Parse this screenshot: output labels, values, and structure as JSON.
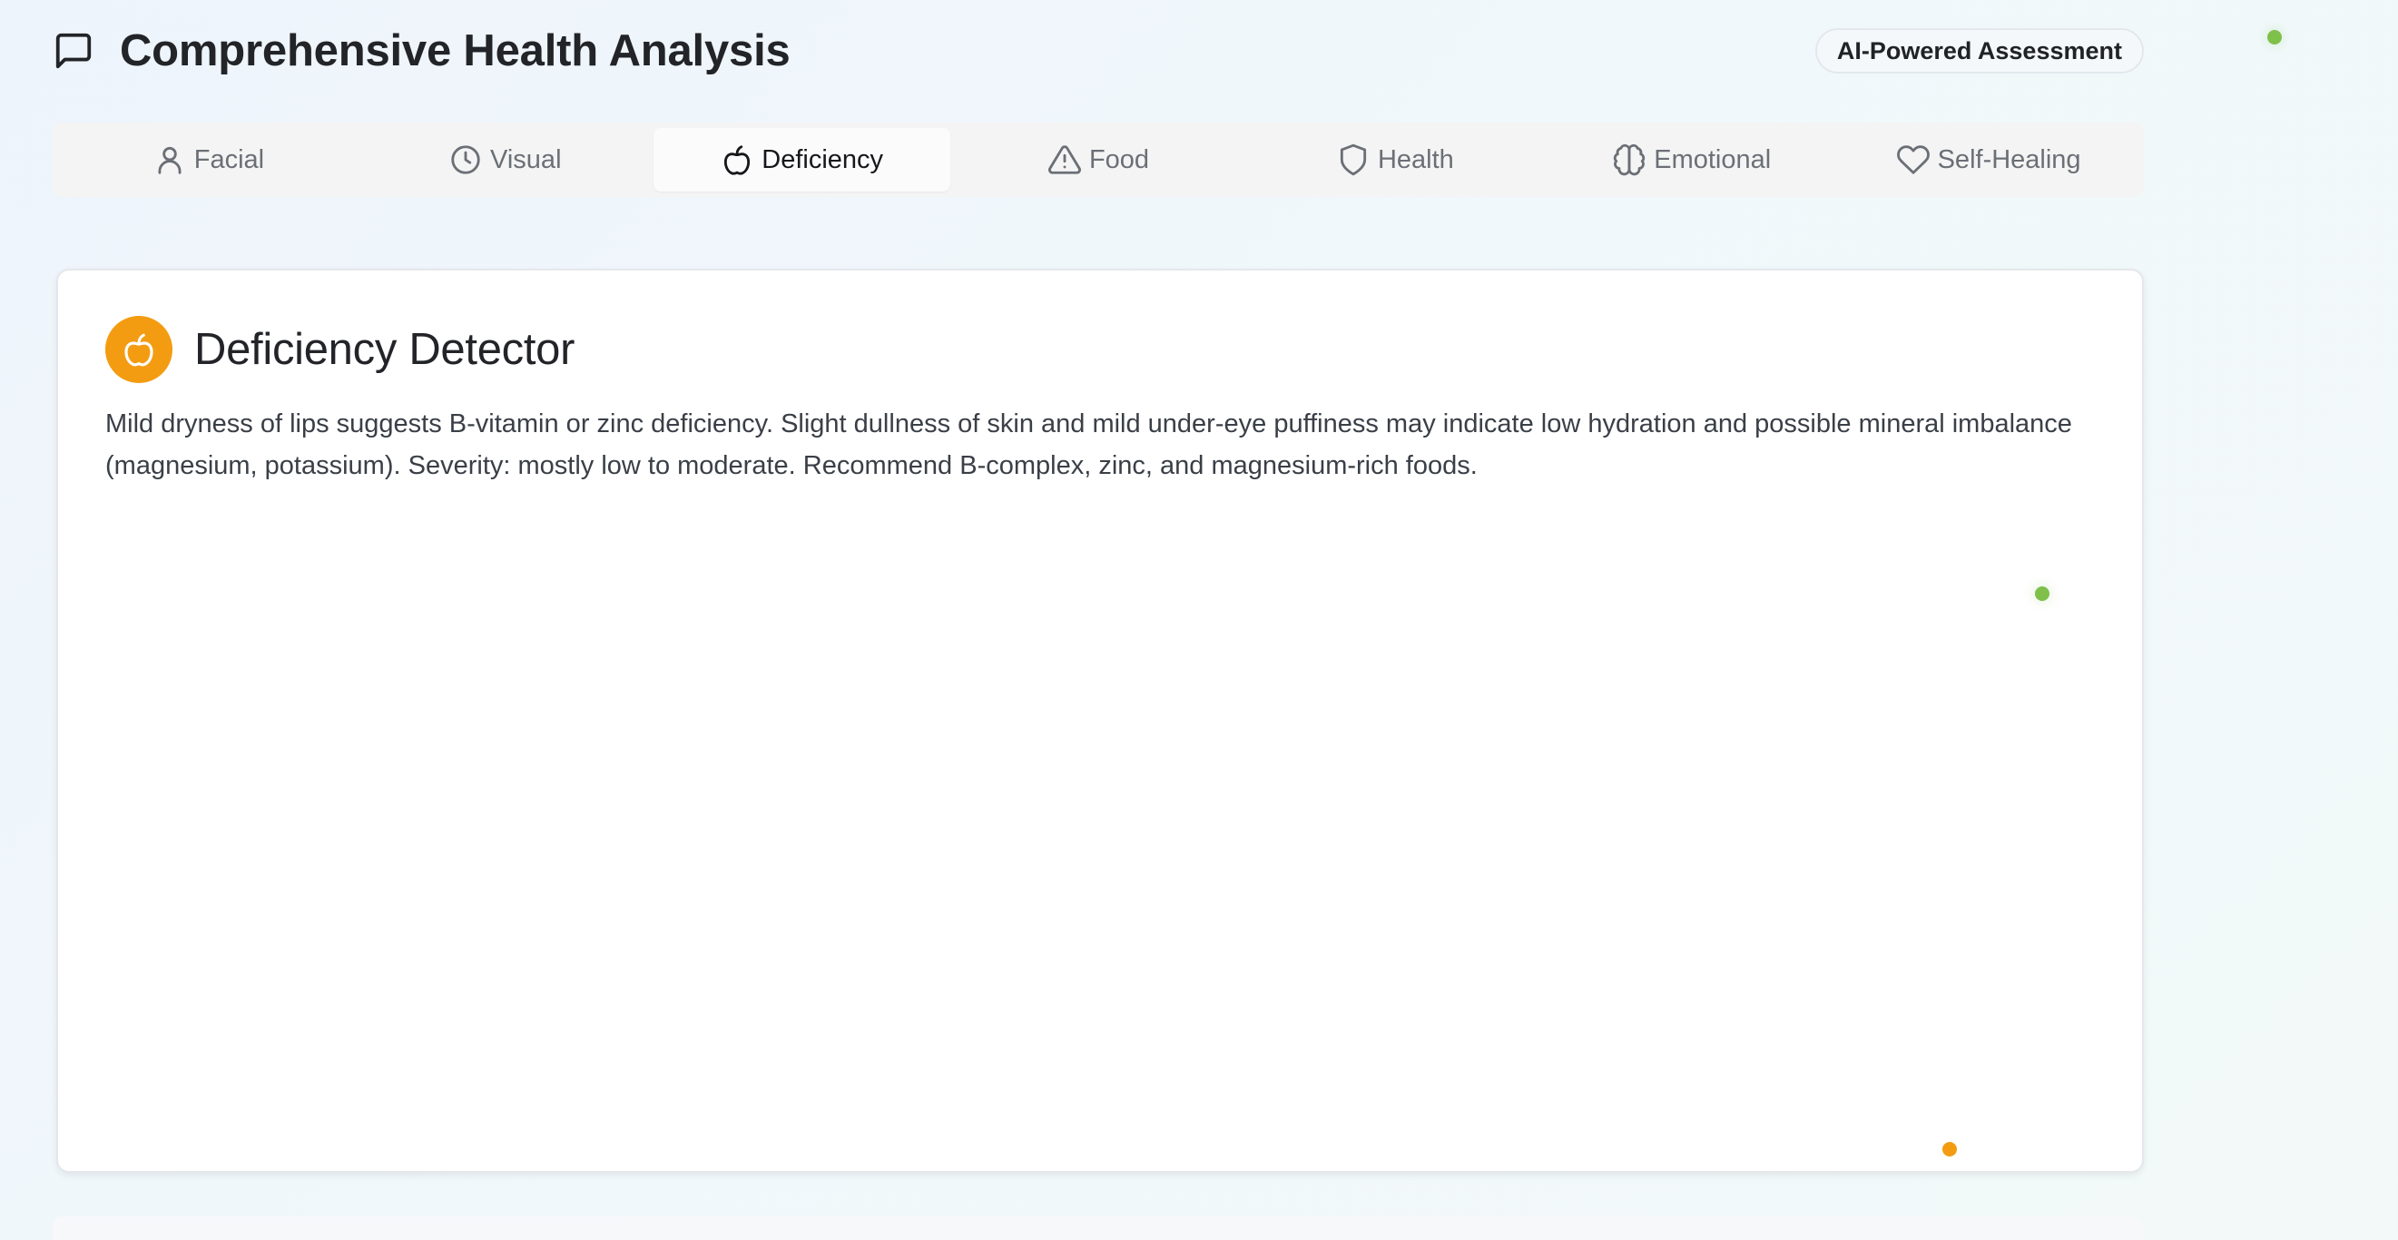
{
  "header": {
    "title": "Comprehensive Health Analysis",
    "badge": "AI-Powered Assessment",
    "icon": "message-square-icon"
  },
  "tabs": [
    {
      "label": "Facial",
      "icon": "user-icon",
      "active": false
    },
    {
      "label": "Visual",
      "icon": "clock-icon",
      "active": false
    },
    {
      "label": "Deficiency",
      "icon": "apple-icon",
      "active": true
    },
    {
      "label": "Food",
      "icon": "alert-triangle-icon",
      "active": false
    },
    {
      "label": "Health",
      "icon": "shield-icon",
      "active": false
    },
    {
      "label": "Emotional",
      "icon": "brain-icon",
      "active": false
    },
    {
      "label": "Self-Healing",
      "icon": "heart-icon",
      "active": false
    }
  ],
  "card": {
    "title": "Deficiency Detector",
    "icon": "apple-icon",
    "body": "Mild dryness of lips suggests B-vitamin or zinc deficiency. Slight dullness of skin and mild under-eye puffiness may indicate low hydration and possible mineral imbalance (magnesium, potassium). Severity: mostly low to moderate. Recommend B-complex, zinc, and magnesium-rich foods."
  },
  "colors": {
    "accent_orange": "#f39c12",
    "dot_green": "#7ec04a",
    "background": "#eef4fb"
  }
}
